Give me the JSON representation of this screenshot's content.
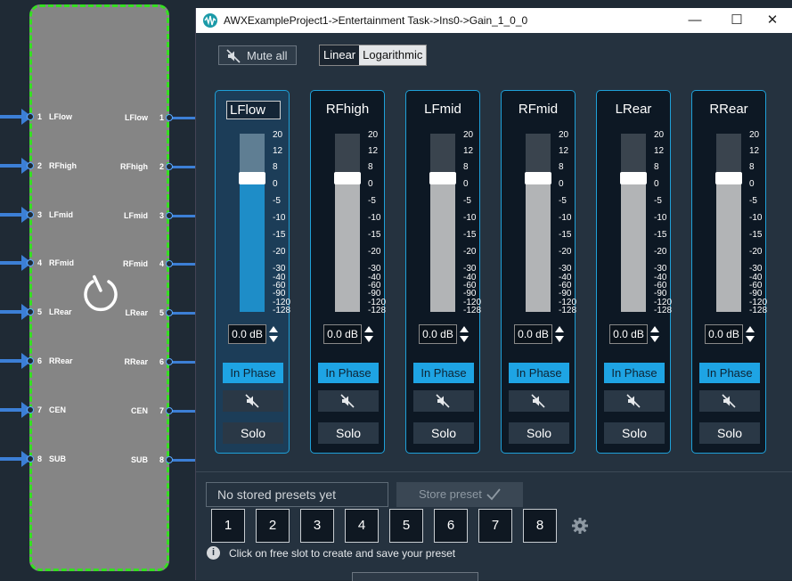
{
  "window": {
    "title": "AWXExampleProject1->Entertainment Task->Ins0->Gain_1_0_0",
    "controls": {
      "minimize": "—",
      "maximize": "☐",
      "close": "✕"
    }
  },
  "toolbar": {
    "mute_all_label": "Mute all",
    "scale_options": [
      "Linear",
      "Logarithmic"
    ],
    "scale_selected": "Linear"
  },
  "block": {
    "inputs": [
      {
        "num": "1",
        "label": "LFlow"
      },
      {
        "num": "2",
        "label": "RFhigh"
      },
      {
        "num": "3",
        "label": "LFmid"
      },
      {
        "num": "4",
        "label": "RFmid"
      },
      {
        "num": "5",
        "label": "LRear"
      },
      {
        "num": "6",
        "label": "RRear"
      },
      {
        "num": "7",
        "label": "CEN"
      },
      {
        "num": "8",
        "label": "SUB"
      }
    ],
    "outputs": [
      {
        "num": "1",
        "label": "LFlow"
      },
      {
        "num": "2",
        "label": "RFhigh"
      },
      {
        "num": "3",
        "label": "LFmid"
      },
      {
        "num": "4",
        "label": "RFmid"
      },
      {
        "num": "5",
        "label": "LRear"
      },
      {
        "num": "6",
        "label": "RRear"
      },
      {
        "num": "7",
        "label": "CEN"
      },
      {
        "num": "8",
        "label": "SUB"
      }
    ]
  },
  "scale_ticks": [
    "20",
    "12",
    "8",
    "0",
    "-5",
    "-10",
    "-15",
    "-20",
    "-30",
    "-40",
    "-60",
    "-90",
    "-120",
    "-128"
  ],
  "channels": [
    {
      "name": "LFlow",
      "gain_label": "0.0 dB",
      "fader_level": 0.75,
      "phase_label": "In Phase",
      "solo_label": "Solo",
      "selected": true
    },
    {
      "name": "RFhigh",
      "gain_label": "0.0 dB",
      "fader_level": 0.75,
      "phase_label": "In Phase",
      "solo_label": "Solo",
      "selected": false
    },
    {
      "name": "LFmid",
      "gain_label": "0.0 dB",
      "fader_level": 0.75,
      "phase_label": "In Phase",
      "solo_label": "Solo",
      "selected": false
    },
    {
      "name": "RFmid",
      "gain_label": "0.0 dB",
      "fader_level": 0.75,
      "phase_label": "In Phase",
      "solo_label": "Solo",
      "selected": false
    },
    {
      "name": "LRear",
      "gain_label": "0.0 dB",
      "fader_level": 0.75,
      "phase_label": "In Phase",
      "solo_label": "Solo",
      "selected": false
    },
    {
      "name": "RRear",
      "gain_label": "0.0 dB",
      "fader_level": 0.75,
      "phase_label": "In Phase",
      "solo_label": "Solo",
      "selected": false
    }
  ],
  "presets": {
    "status": "No stored presets yet",
    "store_label": "Store preset",
    "slots": [
      "1",
      "2",
      "3",
      "4",
      "5",
      "6",
      "7",
      "8"
    ],
    "hint": "Click on free slot to create and save your preset"
  },
  "colors": {
    "accent": "#1ea4e4",
    "block_border": "#35e021",
    "block_fill": "#858585",
    "connector": "#3c7fd6"
  }
}
